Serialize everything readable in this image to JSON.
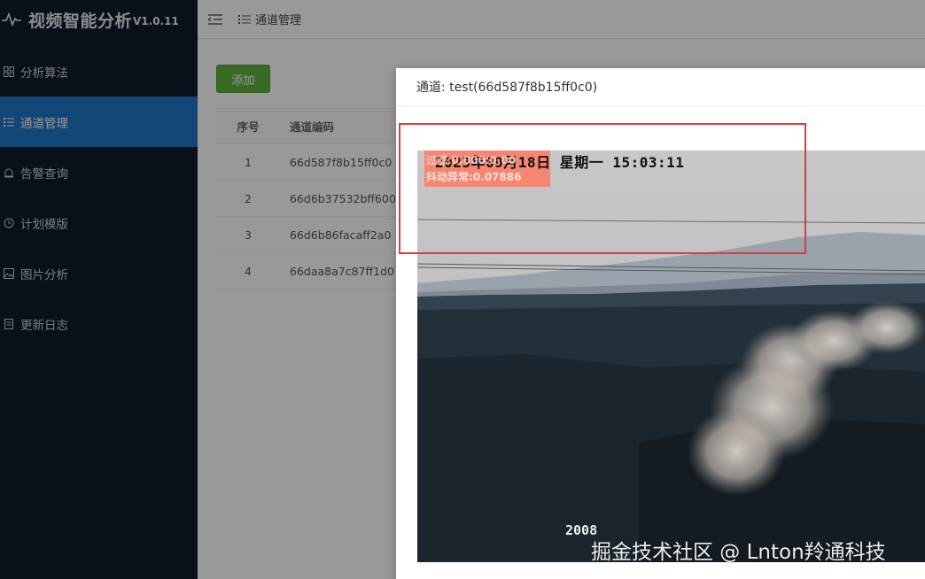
{
  "app": {
    "title": "视频智能分析",
    "version": "V1.0.11"
  },
  "sidebar": {
    "items": [
      {
        "label": "分析算法",
        "icon": "grid-icon"
      },
      {
        "label": "通道管理",
        "icon": "list-icon",
        "active": true
      },
      {
        "label": "告警查询",
        "icon": "alarm-icon"
      },
      {
        "label": "计划模版",
        "icon": "clock-icon"
      },
      {
        "label": "图片分析",
        "icon": "image-icon"
      },
      {
        "label": "更新日志",
        "icon": "doc-icon"
      }
    ]
  },
  "header": {
    "breadcrumb": "通道管理"
  },
  "main": {
    "add_label": "添加",
    "table": {
      "headers": [
        "序号",
        "通道编码"
      ],
      "rows": [
        {
          "idx": "1",
          "code": "66d587f8b15ff0c0"
        },
        {
          "idx": "2",
          "code": "66d6b37532bff600"
        },
        {
          "idx": "3",
          "code": "66d6b86facaff2a0"
        },
        {
          "idx": "4",
          "code": "66daa8a7c87ff1d0"
        }
      ]
    }
  },
  "dialog": {
    "title": "通道: test(66d587f8b15ff0c0)",
    "video": {
      "osd_time": "2023年09月18日  星期一  15:03:11",
      "warn_line1": "过滤:0.000:0.00",
      "warn_line2": "抖动异常:0.07886",
      "osd_number": "2008"
    }
  },
  "watermark": "掘金技术社区 @ Lnton羚通科技",
  "colors": {
    "sidebar_bg": "#121c2c",
    "active_item": "#1f76c5",
    "add_button": "#5fb242",
    "highlight_box": "#e03a3a"
  }
}
